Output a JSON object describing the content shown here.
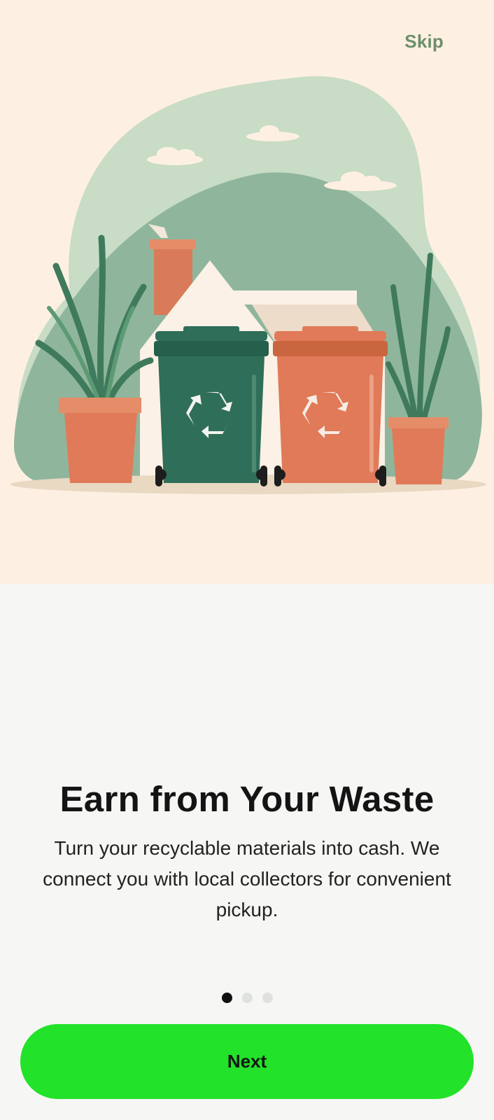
{
  "header": {
    "skip_label": "Skip"
  },
  "onboarding": {
    "title": "Earn from Your Waste",
    "description": "Turn your recyclable materials into cash. We connect you with local collectors for convenient pickup.",
    "current_page": 1,
    "total_pages": 3
  },
  "footer": {
    "next_label": "Next"
  },
  "colors": {
    "accent": "#22e22a",
    "hero_background": "#fdf0e2",
    "skip_text": "#6d8f6a",
    "green_bin": "#2f6e58",
    "orange_bin": "#e07a58"
  },
  "illustration": {
    "description_icon": "recycling-bins-illustration"
  }
}
